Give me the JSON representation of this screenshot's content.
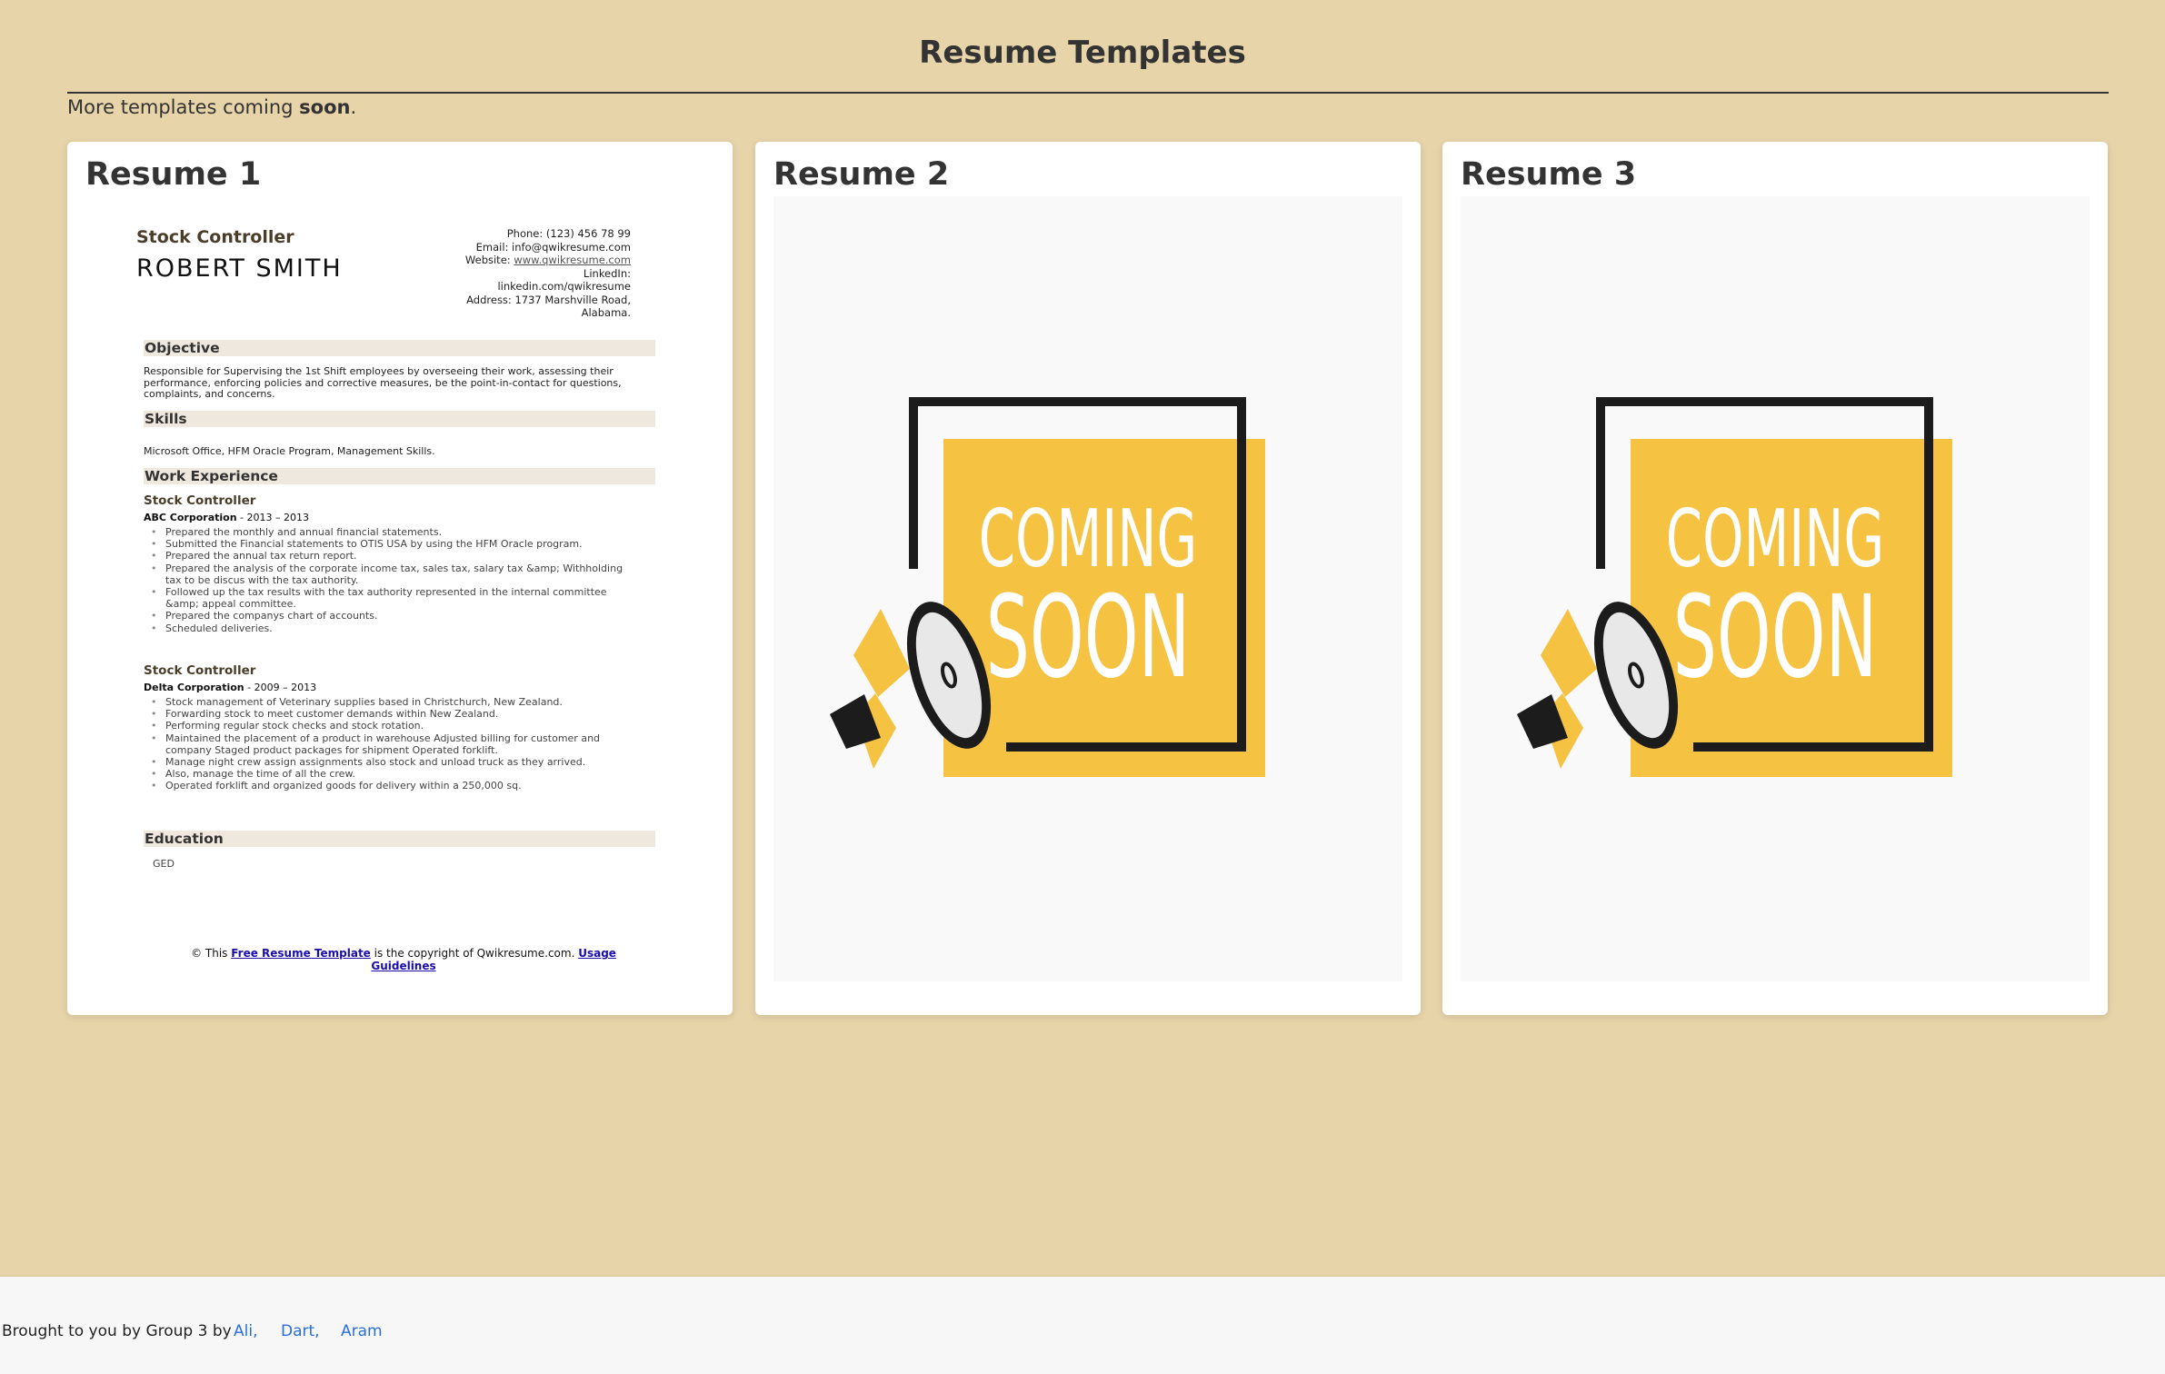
{
  "page": {
    "title": "Resume Templates",
    "notice_prefix": "More templates coming ",
    "notice_bold": "soon",
    "notice_suffix": "."
  },
  "cards": [
    {
      "title": "Resume 1"
    },
    {
      "title": "Resume 2",
      "image_text_top": "COMING",
      "image_text_bottom": "SOON"
    },
    {
      "title": "Resume 3",
      "image_text_top": "COMING",
      "image_text_bottom": "SOON"
    }
  ],
  "resume": {
    "job_title": "Stock Controller",
    "name": "ROBERT SMITH",
    "contact": {
      "phone": "Phone: (123) 456 78 99",
      "email": "Email: info@qwikresume.com",
      "website_label": "Website: ",
      "website": "www.qwikresume.com",
      "linkedin_label": "LinkedIn:",
      "linkedin": "linkedin.com/qwikresume",
      "address_line1": "Address: 1737 Marshville Road,",
      "address_line2": "Alabama."
    },
    "sections": {
      "objective": "Objective",
      "skills": "Skills",
      "work": "Work Experience",
      "education": "Education"
    },
    "objective_text": "Responsible for Supervising the 1st Shift employees by overseeing their work, assessing their performance, enforcing policies and corrective measures, be the point-in-contact for questions, complaints, and concerns.",
    "skills_text": "Microsoft Office, HFM Oracle Program, Management Skills.",
    "jobs": [
      {
        "role": "Stock Controller",
        "company": "ABC Corporation",
        "dates": " - 2013 – 2013",
        "bullets": [
          "Prepared the monthly and annual financial statements.",
          "Submitted the Financial statements to OTIS USA by using the HFM Oracle program.",
          "Prepared the annual tax return report.",
          "Prepared the analysis of the corporate income tax, sales tax, salary tax &amp; Withholding tax to be discus with the tax authority.",
          "Followed up the tax results with the tax authority represented in the internal committee &amp; appeal committee.",
          "Prepared the companys chart of accounts.",
          "Scheduled deliveries."
        ]
      },
      {
        "role": "Stock Controller",
        "company": "Delta Corporation",
        "dates": " - 2009 – 2013",
        "bullets": [
          "Stock management of Veterinary supplies based in Christchurch, New Zealand.",
          "Forwarding stock to meet customer demands within New Zealand.",
          "Performing regular stock checks and stock rotation.",
          "Maintained the placement of a product in warehouse Adjusted billing for customer and company Staged product packages for shipment Operated forklift.",
          "Manage night crew assign assignments also stock and unload truck as they arrived.",
          "Also, manage the time of all the crew.",
          "Operated forklift and organized goods for delivery within a 250,000 sq."
        ]
      }
    ],
    "education_text": "GED",
    "footer": {
      "prefix": "© This ",
      "link1": "Free Resume Template",
      "middle": " is the copyright of Qwikresume.com. ",
      "link2": "Usage Guidelines"
    }
  },
  "footer": {
    "text": "Brought to you by Group 3 by",
    "authors": [
      "Ali,",
      "Dart,",
      "Aram"
    ]
  },
  "colors": {
    "background": "#e8d4a9",
    "card": "#ffffff",
    "coming_soon_yellow": "#f5c242",
    "link": "#2a6edb"
  }
}
